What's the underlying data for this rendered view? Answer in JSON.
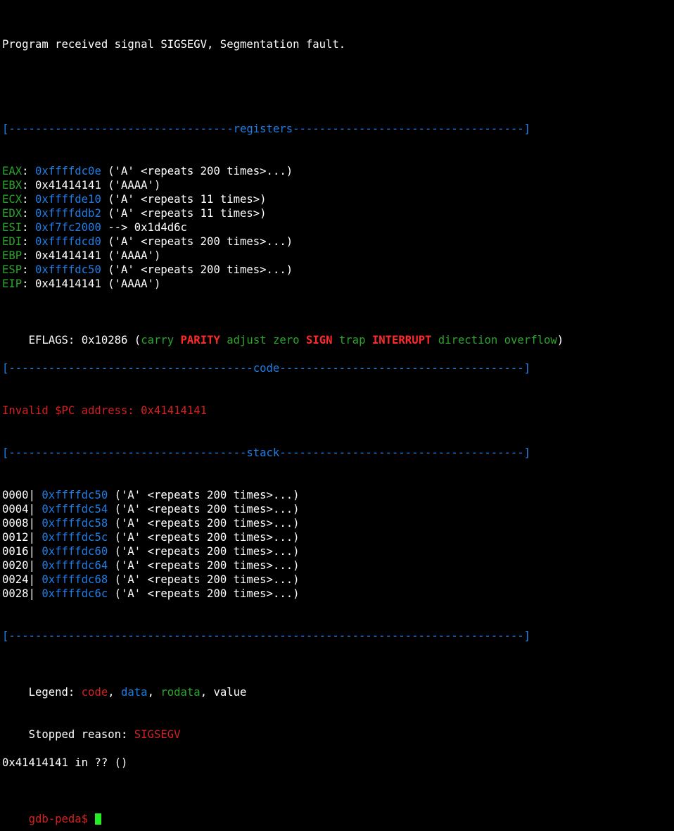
{
  "signal_line": "Program received signal SIGSEGV, Segmentation fault.",
  "headers": {
    "registers": "[----------------------------------registers-----------------------------------]",
    "code": "[-------------------------------------code-------------------------------------]",
    "stack": "[------------------------------------stack-------------------------------------]",
    "end": "[------------------------------------------------------------------------------]"
  },
  "registers": [
    {
      "name": "EAX",
      "sep": ": ",
      "value": "0xffffdc0e",
      "value_kind": "data",
      "desc": " ('A' <repeats 200 times>...)"
    },
    {
      "name": "EBX",
      "sep": ": ",
      "value": "0x41414141",
      "value_kind": "value",
      "desc": " ('AAAA')"
    },
    {
      "name": "ECX",
      "sep": ": ",
      "value": "0xffffde10",
      "value_kind": "data",
      "desc": " ('A' <repeats 11 times>)"
    },
    {
      "name": "EDX",
      "sep": ": ",
      "value": "0xffffddb2",
      "value_kind": "data",
      "desc": " ('A' <repeats 11 times>)"
    },
    {
      "name": "ESI",
      "sep": ": ",
      "value": "0xf7fc2000",
      "value_kind": "data",
      "desc": " --> 0x1d4d6c"
    },
    {
      "name": "EDI",
      "sep": ": ",
      "value": "0xffffdcd0",
      "value_kind": "data",
      "desc": " ('A' <repeats 200 times>...)"
    },
    {
      "name": "EBP",
      "sep": ": ",
      "value": "0x41414141",
      "value_kind": "value",
      "desc": " ('AAAA')"
    },
    {
      "name": "ESP",
      "sep": ": ",
      "value": "0xffffdc50",
      "value_kind": "data",
      "desc": " ('A' <repeats 200 times>...)"
    },
    {
      "name": "EIP",
      "sep": ": ",
      "value": "0x41414141",
      "value_kind": "value",
      "desc": " ('AAAA')"
    }
  ],
  "eflags": {
    "name": "EFLAGS",
    "sep": ": ",
    "value": "0x10286",
    "open": " (",
    "close": ")",
    "flags": [
      {
        "text": "carry",
        "set": false
      },
      {
        "text": "PARITY",
        "set": true
      },
      {
        "text": "adjust",
        "set": false
      },
      {
        "text": "zero",
        "set": false
      },
      {
        "text": "SIGN",
        "set": true
      },
      {
        "text": "trap",
        "set": false
      },
      {
        "text": "INTERRUPT",
        "set": true
      },
      {
        "text": "direction",
        "set": false
      },
      {
        "text": "overflow",
        "set": false
      }
    ]
  },
  "code_message": "Invalid $PC address: 0x41414141",
  "stack": [
    {
      "offset": "0000",
      "sep": "| ",
      "address": "0xffffdc50",
      "desc": " ('A' <repeats 200 times>...)"
    },
    {
      "offset": "0004",
      "sep": "| ",
      "address": "0xffffdc54",
      "desc": " ('A' <repeats 200 times>...)"
    },
    {
      "offset": "0008",
      "sep": "| ",
      "address": "0xffffdc58",
      "desc": " ('A' <repeats 200 times>...)"
    },
    {
      "offset": "0012",
      "sep": "| ",
      "address": "0xffffdc5c",
      "desc": " ('A' <repeats 200 times>...)"
    },
    {
      "offset": "0016",
      "sep": "| ",
      "address": "0xffffdc60",
      "desc": " ('A' <repeats 200 times>...)"
    },
    {
      "offset": "0020",
      "sep": "| ",
      "address": "0xffffdc64",
      "desc": " ('A' <repeats 200 times>...)"
    },
    {
      "offset": "0024",
      "sep": "| ",
      "address": "0xffffdc68",
      "desc": " ('A' <repeats 200 times>...)"
    },
    {
      "offset": "0028",
      "sep": "| ",
      "address": "0xffffdc6c",
      "desc": " ('A' <repeats 200 times>...)"
    }
  ],
  "legend": {
    "label": "Legend: ",
    "code": "code",
    "comma1": ", ",
    "data": "data",
    "comma2": ", ",
    "rodata": "rodata",
    "comma3": ", ",
    "value": "value"
  },
  "stopped": {
    "label": "Stopped reason: ",
    "reason": "SIGSEGV"
  },
  "frame_line": "0x41414141 in ?? ()",
  "prompt": "gdb-peda$ ",
  "colors": {
    "background": "#000000",
    "foreground": "#ffffff",
    "data_blue": "#1e7ee6",
    "register_green": "#2aa52a",
    "code_red": "#d42020",
    "flag_set_red": "#ff2a2a",
    "cursor_green": "#22ee22"
  }
}
